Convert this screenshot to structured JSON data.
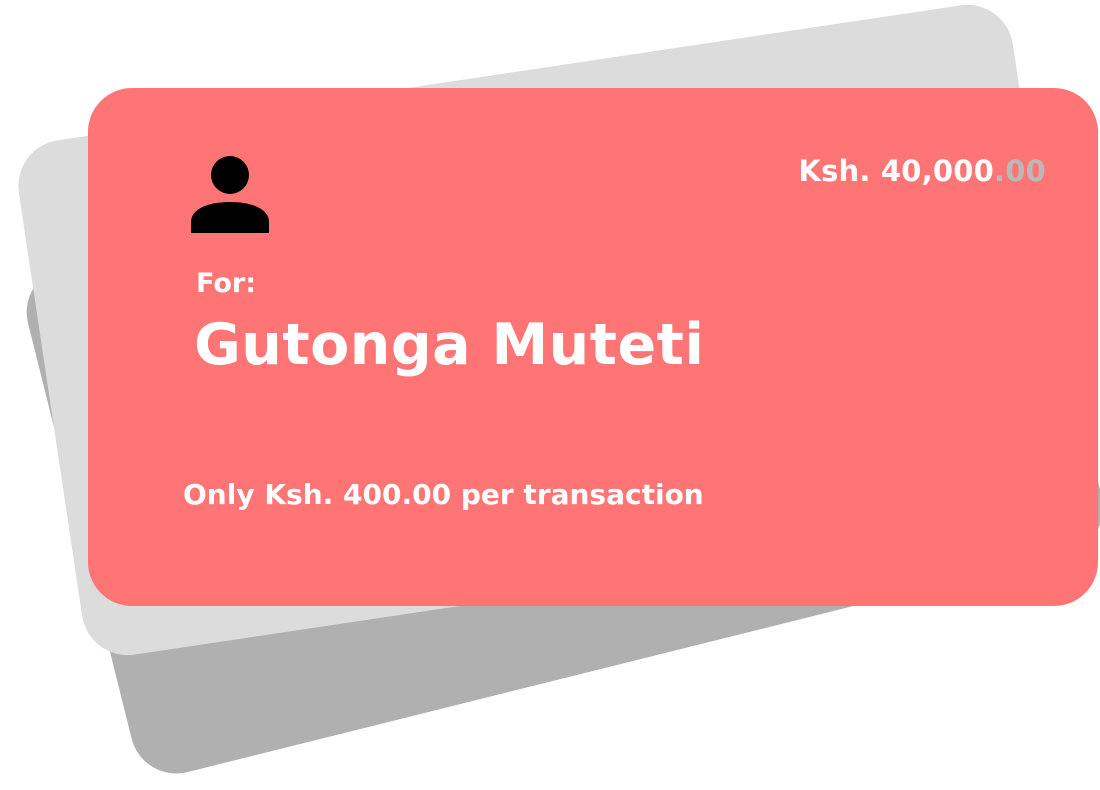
{
  "card": {
    "amount_main": "Ksh. 40,000",
    "amount_cents": ".00",
    "for_label": "For:",
    "recipient_name": "Gutonga Muteti",
    "limit_text": "Only Ksh. 400.00 per transaction",
    "icon": "user-icon"
  },
  "colors": {
    "front_card": "#ff7474",
    "middle_card": "#dcdcdc",
    "back_card": "#b0b0b0",
    "text": "#ffffff",
    "muted_cents": "#b9b9b9"
  }
}
